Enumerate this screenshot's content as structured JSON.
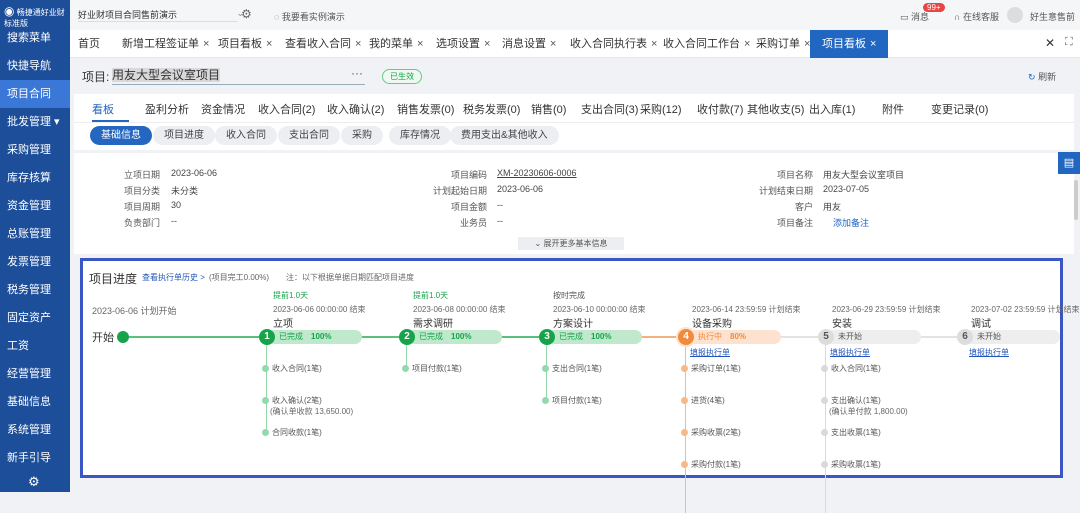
{
  "app": {
    "brand": "畅捷通好业财",
    "edition": "标准版"
  },
  "topbar": {
    "account_select": "好业财项目合同售前演示",
    "demo_link": "我要看实例演示",
    "messages": "消息",
    "message_count": "99+",
    "support": "在线客服",
    "user": "好生意售前"
  },
  "sidebar": {
    "items": [
      {
        "label": "搜索菜单"
      },
      {
        "label": "快捷导航"
      },
      {
        "label": "项目合同",
        "active": true
      },
      {
        "label": "批发管理 ▾"
      },
      {
        "label": "采购管理"
      },
      {
        "label": "库存核算"
      },
      {
        "label": "资金管理"
      },
      {
        "label": "总账管理"
      },
      {
        "label": "发票管理"
      },
      {
        "label": "税务管理"
      },
      {
        "label": "固定资产"
      },
      {
        "label": "工资"
      },
      {
        "label": "经营管理"
      },
      {
        "label": "基础信息"
      },
      {
        "label": "系统管理"
      },
      {
        "label": "新手引导"
      }
    ]
  },
  "tabs": [
    {
      "label": "首页"
    },
    {
      "label": "新增工程签证单"
    },
    {
      "label": "项目看板"
    },
    {
      "label": "查看收入合同"
    },
    {
      "label": "我的菜单"
    },
    {
      "label": "选项设置"
    },
    {
      "label": "消息设置"
    },
    {
      "label": "收入合同执行表"
    },
    {
      "label": "收入合同工作台"
    },
    {
      "label": "采购订单"
    },
    {
      "label": "项目看板",
      "active": true
    }
  ],
  "project": {
    "label": "项目:",
    "name": "用友大型会议室项目",
    "more": "···",
    "status": "已生效",
    "refresh": "刷新"
  },
  "subtabs": [
    "看板",
    "盈利分析",
    "资金情况",
    "收入合同(2)",
    "收入确认(2)",
    "销售发票(0)",
    "税务发票(0)",
    "销售(0)",
    "支出合同(3)",
    "采购(12)",
    "收付款(7)",
    "其他收支(5)",
    "出入库(1)",
    "附件",
    "变更记录(0)"
  ],
  "pills": [
    "基础信息",
    "项目进度",
    "收入合同",
    "支出合同",
    "采购",
    "库存情况",
    "费用支出&其他收入"
  ],
  "info": {
    "col1": [
      [
        "立项日期",
        "2023-06-06"
      ],
      [
        "项目分类",
        "未分类"
      ],
      [
        "项目周期",
        "30"
      ],
      [
        "负责部门",
        "--"
      ]
    ],
    "col2": [
      [
        "项目编码",
        "XM-20230606-0006"
      ],
      [
        "计划起始日期",
        "2023-06-06"
      ],
      [
        "项目金额",
        "--"
      ],
      [
        "业务员",
        "--"
      ]
    ],
    "col3": [
      [
        "项目名称",
        "用友大型会议室项目"
      ],
      [
        "计划结束日期",
        "2023-07-05"
      ],
      [
        "客户",
        "用友"
      ],
      [
        "项目备注",
        "添加备注"
      ]
    ],
    "expand": "展开更多基本信息"
  },
  "progress": {
    "title": "项目进度",
    "history": "查看执行单历史 >",
    "completion": "(项目完工0.00%)",
    "note": "注：以下根据单据日期匹配项目进度",
    "start_date": "2023-06-06 计划开始",
    "start_label": "开始",
    "stages": [
      {
        "num": "1",
        "tag": "提前1.0天",
        "date": "2023-06-06 00:00:00 结束",
        "name": "立项",
        "state": "已完成",
        "pct": "100%",
        "status": "done",
        "items": [
          "收入合同(1笔)",
          "收入确认(2笔)",
          "合同收款(1笔)"
        ],
        "notes": {
          "1": "(确认单收款 13,650.00)"
        }
      },
      {
        "num": "2",
        "tag": "提前1.0天",
        "date": "2023-06-08 00:00:00 结束",
        "name": "需求调研",
        "state": "已完成",
        "pct": "100%",
        "status": "done",
        "items": [
          "项目付款(1笔)"
        ]
      },
      {
        "num": "3",
        "tag": "按时完成",
        "date": "2023-06-10 00:00:00 结束",
        "name": "方案设计",
        "state": "已完成",
        "pct": "100%",
        "status": "done",
        "items": [
          "支出合同(1笔)",
          "项目付款(1笔)"
        ]
      },
      {
        "num": "4",
        "tag": "",
        "date": "2023-06-14 23:59:59 计划结束",
        "name": "设备采购",
        "state": "执行中",
        "pct": "80%",
        "status": "active",
        "fill": "填报执行单",
        "items": [
          "采购订单(1笔)",
          "进货(4笔)",
          "采购收票(2笔)",
          "采购付款(1笔)"
        ]
      },
      {
        "num": "5",
        "tag": "",
        "date": "2023-06-29 23:59:59 计划结束",
        "name": "安装",
        "state": "未开始",
        "pct": "",
        "status": "todo",
        "fill": "填报执行单",
        "items": [
          "收入合同(1笔)",
          "支出确认(1笔)",
          "支出收票(1笔)",
          "采购收票(1笔)"
        ],
        "notes": {
          "1": "(确认单付款 1,800.00)"
        }
      },
      {
        "num": "6",
        "tag": "",
        "date": "2023-07-02 23:59:59 计划结束",
        "name": "调试",
        "state": "未开始",
        "pct": "",
        "status": "todo",
        "fill": "填报执行单",
        "items": []
      }
    ]
  },
  "colors": {
    "brand": "#1d4e9a",
    "accent": "#2166c0",
    "done": "#16a34a",
    "active": "#f08a3c",
    "todo": "#cccccc",
    "highlight_border": "#3a56c5"
  }
}
